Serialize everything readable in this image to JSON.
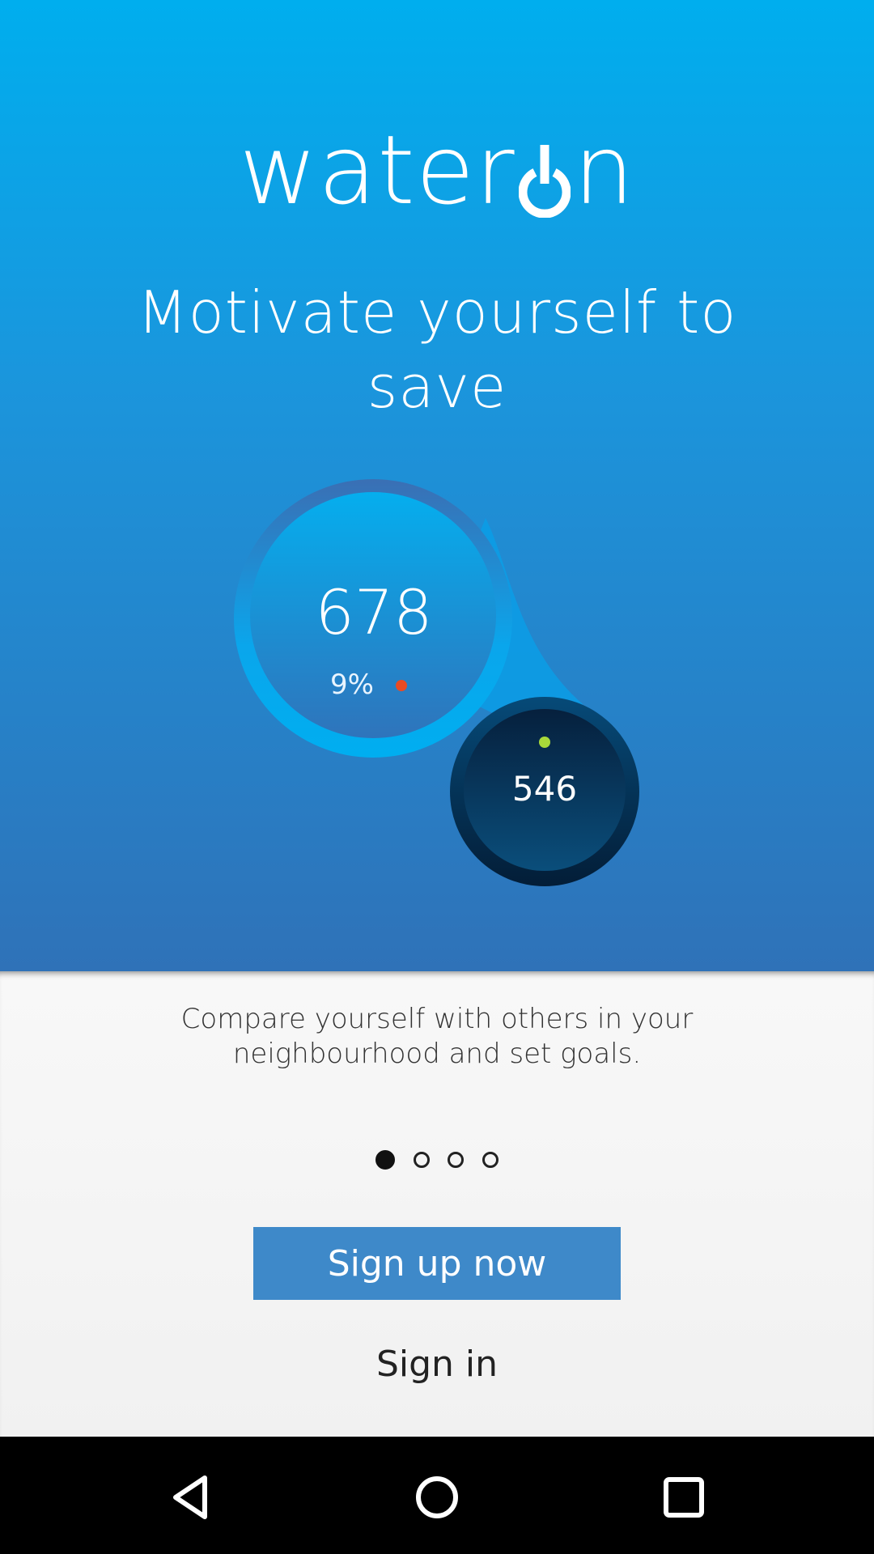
{
  "app": {
    "logo_text_left": "water",
    "logo_text_right": "n",
    "brand_color": "#00aeee"
  },
  "hero": {
    "headline": "Motivate yourself to save"
  },
  "graphic": {
    "big_value": "678",
    "big_percent": "9%",
    "small_value": "546",
    "status_dot_red": "#e94b24",
    "status_dot_green": "#a8d93a"
  },
  "panel": {
    "description": "Compare yourself with others in your neighbourhood and  set goals.",
    "pager": {
      "total": 4,
      "active": 1
    },
    "signup_label": "Sign up now",
    "signin_label": "Sign in"
  },
  "navbar": {
    "back_icon": "back-triangle-icon",
    "home_icon": "home-circle-icon",
    "recents_icon": "recents-square-icon"
  }
}
